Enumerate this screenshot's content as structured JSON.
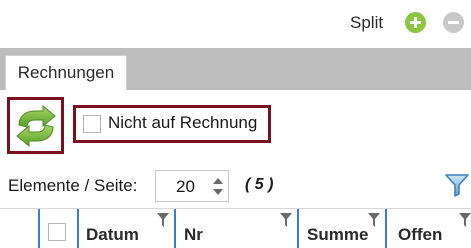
{
  "toolbar": {
    "split_label": "Split",
    "add_icon": "plus-circle-icon",
    "remove_icon": "minus-circle-icon",
    "add_color": "#8cc63f",
    "remove_color": "#c8c8c8"
  },
  "tabs": [
    {
      "label": "Rechnungen",
      "active": true
    }
  ],
  "actions": {
    "refresh_icon": "refresh-icon",
    "refresh_color": "#7cc043",
    "not_on_invoice_label": "Nicht auf Rechnung",
    "not_on_invoice_checked": false,
    "highlight_color": "#7a1020"
  },
  "paging": {
    "per_page_label": "Elemente / Seite:",
    "per_page_value": "20",
    "count": "( 5 )",
    "filter_icon": "funnel-icon"
  },
  "grid": {
    "columns": [
      {
        "label": "Datum"
      },
      {
        "label": "Nr"
      },
      {
        "label": "Summe"
      },
      {
        "label": "Offen"
      }
    ],
    "separator_color": "#3a7bd5"
  }
}
